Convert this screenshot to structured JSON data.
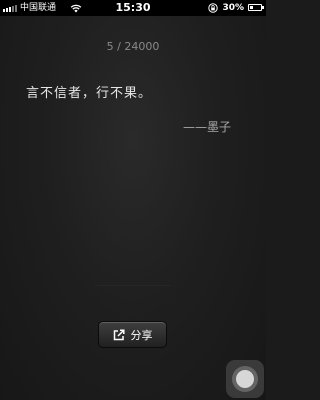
{
  "status_bar": {
    "carrier": "中国联通",
    "time": "15:30",
    "battery_text": "30%",
    "battery_level": 0.3,
    "icons": [
      "signal-icon",
      "wifi-icon",
      "rotation-lock-icon",
      "battery-icon"
    ]
  },
  "content": {
    "counter": "5 / 24000",
    "quote": "言不信者，行不果。",
    "author": "——墨子"
  },
  "share": {
    "label": "分享",
    "icon": "share-icon"
  },
  "colors": {
    "background": "#1b1b1b",
    "quote_text": "#e6e6e6",
    "muted_text": "#8a8a8a"
  }
}
